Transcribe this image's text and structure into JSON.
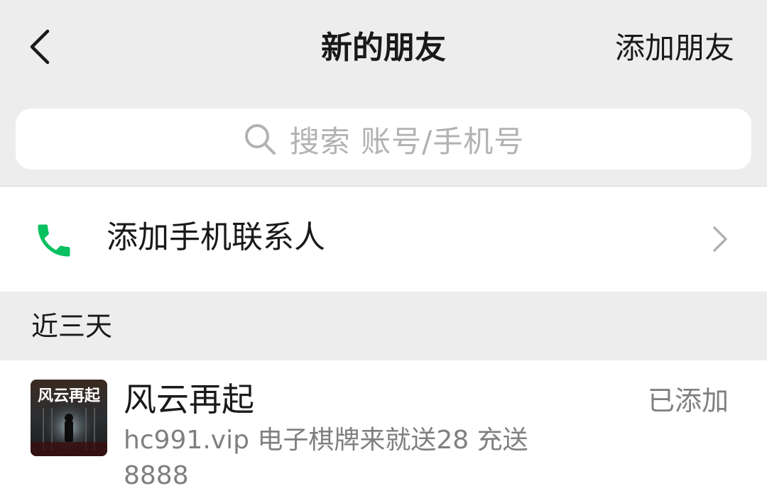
{
  "header": {
    "back_icon": "chevron-left-icon",
    "title": "新的朋友",
    "add_friend_label": "添加朋友"
  },
  "search": {
    "icon": "search-icon",
    "placeholder": "搜索 账号/手机号"
  },
  "phone_contacts": {
    "icon": "phone-icon",
    "icon_color": "#07c160",
    "label": "添加手机联系人",
    "chevron": "chevron-right-icon"
  },
  "section": {
    "title": "近三天"
  },
  "friends": [
    {
      "name": "风云再起",
      "message": "hc991.vip  电子棋牌来就送28 充送8888",
      "status": "已添加",
      "avatar_text": "风云再起"
    }
  ],
  "colors": {
    "background": "#ededed",
    "surface": "#ffffff",
    "secondary_text": "#7f7f7f",
    "placeholder": "#b2b2b2"
  }
}
